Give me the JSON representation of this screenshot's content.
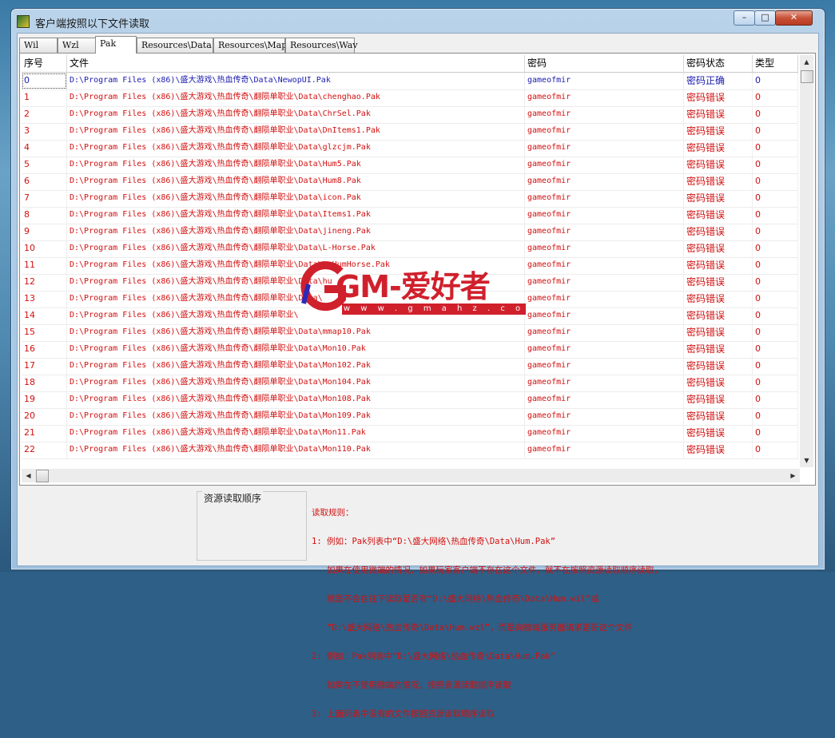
{
  "window": {
    "title": "客户端按照以下文件读取",
    "minimize": "–",
    "maximize": "□",
    "close": "✕"
  },
  "tabs": [
    {
      "label": "Wil"
    },
    {
      "label": "Wzl"
    },
    {
      "label": "Pak"
    },
    {
      "label": "Resources\\Data"
    },
    {
      "label": "Resources\\Map"
    },
    {
      "label": "Resources\\Wav"
    }
  ],
  "table": {
    "headers": {
      "index": "序号",
      "file": "文件",
      "password": "密码",
      "status": "密码状态",
      "type": "类型"
    },
    "rows": [
      {
        "index": "0",
        "file": "D:\\Program Files (x86)\\盛大游戏\\热血传奇\\Data\\NewopUI.Pak",
        "password": "gameofmir",
        "status": "密码正确",
        "type": "0"
      },
      {
        "index": "1",
        "file": "D:\\Program Files (x86)\\盛大游戏\\热血传奇\\翻陨单职业\\Data\\chenghao.Pak",
        "password": "gameofmir",
        "status": "密码错误",
        "type": "0"
      },
      {
        "index": "2",
        "file": "D:\\Program Files (x86)\\盛大游戏\\热血传奇\\翻陨单职业\\Data\\ChrSel.Pak",
        "password": "gameofmir",
        "status": "密码错误",
        "type": "0"
      },
      {
        "index": "3",
        "file": "D:\\Program Files (x86)\\盛大游戏\\热血传奇\\翻陨单职业\\Data\\DnItems1.Pak",
        "password": "gameofmir",
        "status": "密码错误",
        "type": "0"
      },
      {
        "index": "4",
        "file": "D:\\Program Files (x86)\\盛大游戏\\热血传奇\\翻陨单职业\\Data\\glzcjm.Pak",
        "password": "gameofmir",
        "status": "密码错误",
        "type": "0"
      },
      {
        "index": "5",
        "file": "D:\\Program Files (x86)\\盛大游戏\\热血传奇\\翻陨单职业\\Data\\Hum5.Pak",
        "password": "gameofmir",
        "status": "密码错误",
        "type": "0"
      },
      {
        "index": "6",
        "file": "D:\\Program Files (x86)\\盛大游戏\\热血传奇\\翻陨单职业\\Data\\Hum8.Pak",
        "password": "gameofmir",
        "status": "密码错误",
        "type": "0"
      },
      {
        "index": "7",
        "file": "D:\\Program Files (x86)\\盛大游戏\\热血传奇\\翻陨单职业\\Data\\icon.Pak",
        "password": "gameofmir",
        "status": "密码错误",
        "type": "0"
      },
      {
        "index": "8",
        "file": "D:\\Program Files (x86)\\盛大游戏\\热血传奇\\翻陨单职业\\Data\\Items1.Pak",
        "password": "gameofmir",
        "status": "密码错误",
        "type": "0"
      },
      {
        "index": "9",
        "file": "D:\\Program Files (x86)\\盛大游戏\\热血传奇\\翻陨单职业\\Data\\jineng.Pak",
        "password": "gameofmir",
        "status": "密码错误",
        "type": "0"
      },
      {
        "index": "10",
        "file": "D:\\Program Files (x86)\\盛大游戏\\热血传奇\\翻陨单职业\\Data\\L-Horse.Pak",
        "password": "gameofmir",
        "status": "密码错误",
        "type": "0"
      },
      {
        "index": "11",
        "file": "D:\\Program Files (x86)\\盛大游戏\\热血传奇\\翻陨单职业\\Data\\L-HumHorse.Pak",
        "password": "gameofmir",
        "status": "密码错误",
        "type": "0"
      },
      {
        "index": "12",
        "file": "D:\\Program Files (x86)\\盛大游戏\\热血传奇\\翻陨单职业\\Data\\hu",
        "password": "gameofmir",
        "status": "密码错误",
        "type": "0"
      },
      {
        "index": "13",
        "file": "D:\\Program Files (x86)\\盛大游戏\\热血传奇\\翻陨单职业\\Data\\",
        "password": "gameofmir",
        "status": "密码错误",
        "type": "0"
      },
      {
        "index": "14",
        "file": "D:\\Program Files (x86)\\盛大游戏\\热血传奇\\翻陨单职业\\",
        "password": "gameofmir",
        "status": "密码错误",
        "type": "0"
      },
      {
        "index": "15",
        "file": "D:\\Program Files (x86)\\盛大游戏\\热血传奇\\翻陨单职业\\Data\\mmap10.Pak",
        "password": "gameofmir",
        "status": "密码错误",
        "type": "0"
      },
      {
        "index": "16",
        "file": "D:\\Program Files (x86)\\盛大游戏\\热血传奇\\翻陨单职业\\Data\\Mon10.Pak",
        "password": "gameofmir",
        "status": "密码错误",
        "type": "0"
      },
      {
        "index": "17",
        "file": "D:\\Program Files (x86)\\盛大游戏\\热血传奇\\翻陨单职业\\Data\\Mon102.Pak",
        "password": "gameofmir",
        "status": "密码错误",
        "type": "0"
      },
      {
        "index": "18",
        "file": "D:\\Program Files (x86)\\盛大游戏\\热血传奇\\翻陨单职业\\Data\\Mon104.Pak",
        "password": "gameofmir",
        "status": "密码错误",
        "type": "0"
      },
      {
        "index": "19",
        "file": "D:\\Program Files (x86)\\盛大游戏\\热血传奇\\翻陨单职业\\Data\\Mon108.Pak",
        "password": "gameofmir",
        "status": "密码错误",
        "type": "0"
      },
      {
        "index": "20",
        "file": "D:\\Program Files (x86)\\盛大游戏\\热血传奇\\翻陨单职业\\Data\\Mon109.Pak",
        "password": "gameofmir",
        "status": "密码错误",
        "type": "0"
      },
      {
        "index": "21",
        "file": "D:\\Program Files (x86)\\盛大游戏\\热血传奇\\翻陨单职业\\Data\\Mon11.Pak",
        "password": "gameofmir",
        "status": "密码错误",
        "type": "0"
      },
      {
        "index": "22",
        "file": "D:\\Program Files (x86)\\盛大游戏\\热血传奇\\翻陨单职业\\Data\\Mon110.Pak",
        "password": "gameofmir",
        "status": "密码错误",
        "type": "0"
      }
    ]
  },
  "bottom": {
    "group_title": "资源读取顺序",
    "rules": [
      "读取规则：",
      "1: 例如：Pak列表中“D:\\盛大网络\\热血传奇\\Data\\Hum.Pak”",
      "   如果在使用微端的情况，如果玩家客户端不存在这个文件，就不在按照资源读取顺序读取，",
      "   就是不会在往下读取是否有“D:\\盛大网络\\热血传奇\\Data\\Hum.wil”或",
      "   “D:\\盛大网络\\热血传奇\\Data\\Hum.wzl”，而是向微端服务器请求更新这个文件",
      "2: 例如：Pak列表中“D:\\盛大网络\\热血传奇\\Data\\Hum.Pak”",
      "   如果在不使用微端的情况，按照资源读取顺序读取",
      "3: 上面列表中没有的文件按照资源读取顺序读取"
    ]
  },
  "watermark": {
    "brand": "GM-爱好者",
    "url": "w w w . g m a h z . c o m"
  },
  "colors": {
    "ok": "#1a1ab0",
    "error": "#d21010",
    "watermark": "#d0202c"
  }
}
